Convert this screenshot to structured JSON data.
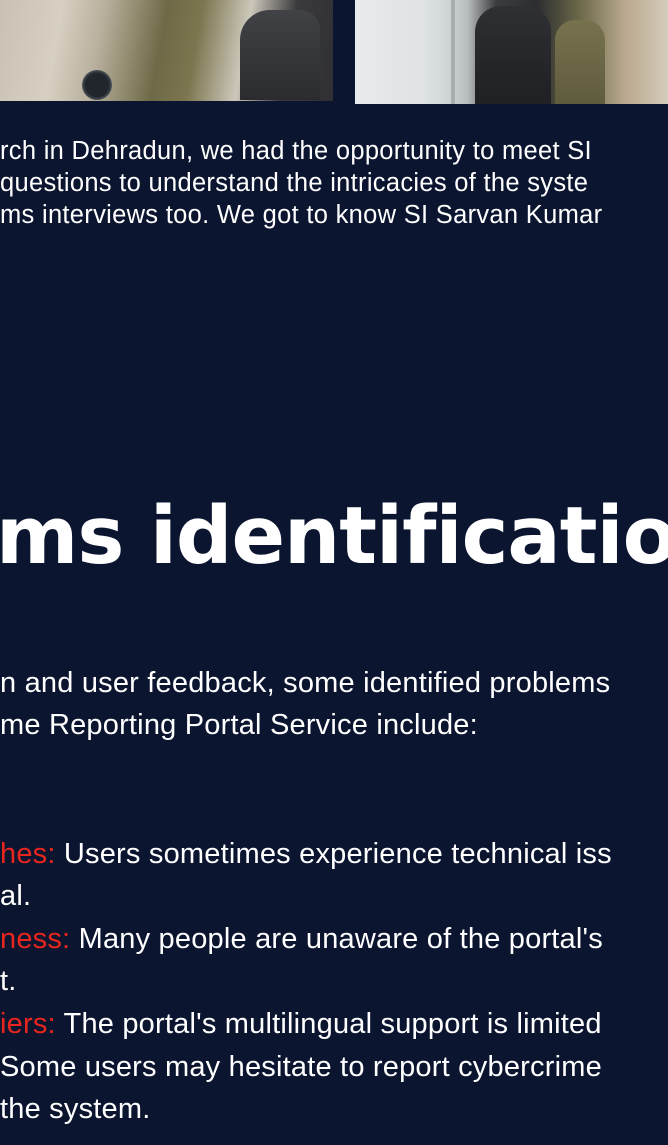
{
  "intro": {
    "line1": "rch in Dehradun, we had the opportunity to meet SI",
    "line2": " questions to understand the intricacies of the syste",
    "line3": "ms interviews too. We got to know SI Sarvan Kumar"
  },
  "section": {
    "heading": "ms identification"
  },
  "summary": {
    "line1": "n and user feedback, some identified problems",
    "line2": "me Reporting Portal Service include:"
  },
  "problems": [
    {
      "label": "hes:",
      "text": " Users sometimes experience technical iss"
    },
    {
      "label": "",
      "text": "al."
    },
    {
      "label": "ness:",
      "text": " Many people are unaware of the portal's"
    },
    {
      "label": "",
      "text": "t."
    },
    {
      "label": "iers:",
      "text": " The portal's multilingual support is limited"
    },
    {
      "label": "",
      "text": "Some users may hesitate to report cybercrime"
    },
    {
      "label": "",
      "text": " the system."
    }
  ],
  "colors": {
    "background": "#0b1530",
    "accent_red": "#e8261e",
    "text": "#ffffff"
  }
}
